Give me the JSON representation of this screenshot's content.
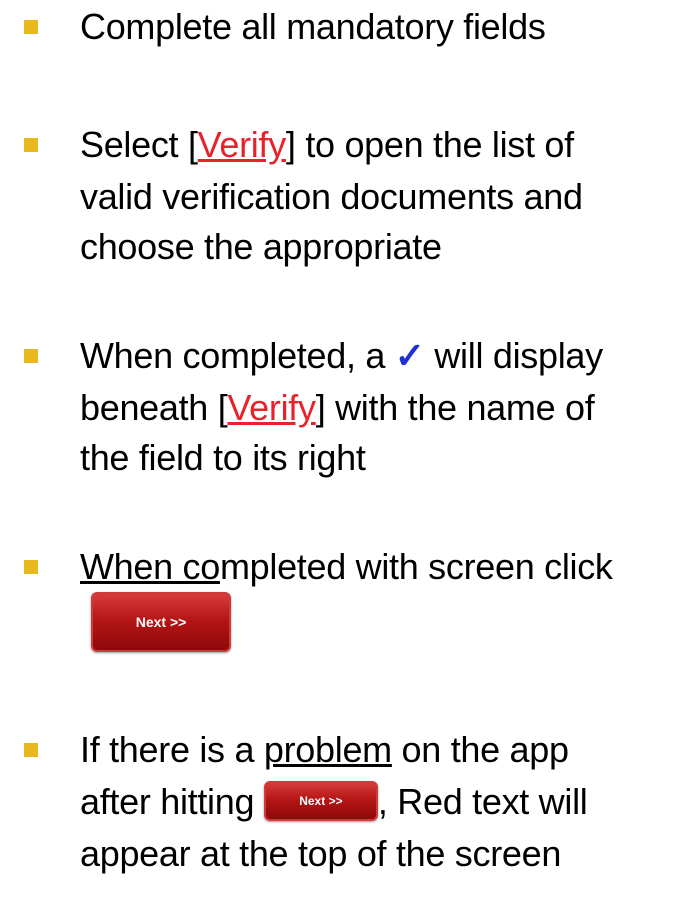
{
  "colors": {
    "bullet": "#e8b91f",
    "verify_link": "#e8222a",
    "check_mark": "#1f2fd8",
    "button_bg": "#b61616"
  },
  "items": [
    {
      "text": "Complete all mandatory fields"
    },
    {
      "part1": "Select [",
      "link": "Verify",
      "part2": "]  to open the list of",
      "line2": "valid verification documents and",
      "line3": "choose the appropriate"
    },
    {
      "part1": "When completed, a ",
      "check": "✓",
      "part2": " will display",
      "line2_part1": "beneath [",
      "link": "Verify",
      "line2_part2": "] with the name of",
      "line3": "the field to its right"
    },
    {
      "part1_underlined": "When co",
      "part1_rest": "mpleted with screen click",
      "button_label": "Next >>"
    },
    {
      "line1_part1": "If there is a ",
      "line1_underlined": "problem",
      "line1_part2": " on the app",
      "line2_part1": "after hitting ",
      "button_label": "Next >>",
      "line2_part2": ", Red text will",
      "line3": "appear at the top of the screen"
    }
  ]
}
